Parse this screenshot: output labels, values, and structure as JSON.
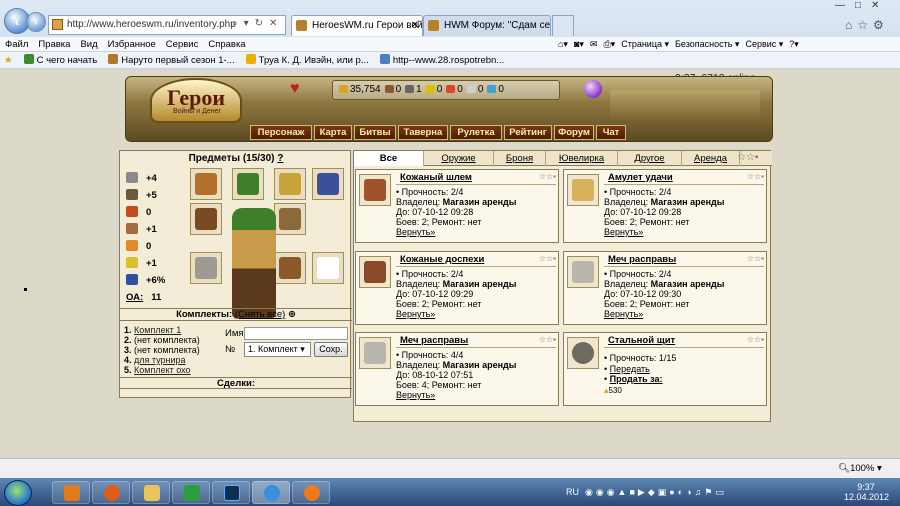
{
  "browser": {
    "url": "http://www.heroeswm.ru/inventory.php",
    "tabs": [
      {
        "label": "HeroesWM.ru Герои войн..."
      },
      {
        "label": "HWM Форум: \"Сдам сеты Ва..."
      }
    ],
    "menu": [
      "Файл",
      "Правка",
      "Вид",
      "Избранное",
      "Сервис",
      "Справка"
    ],
    "toolbar": {
      "page": "Страница ▾",
      "security": "Безопасность ▾",
      "service": "Сервис ▾"
    },
    "favorites": [
      {
        "label": "С чего начать",
        "color": "#3a8d2a"
      },
      {
        "label": "Наруто первый сезон 1-...",
        "color": "#b0782c"
      },
      {
        "label": "Труа К. Д. Ивэйн, или р...",
        "color": "#e7b300"
      },
      {
        "label": "http--www.28.rospotrebn...",
        "color": "#4a7fc0"
      }
    ]
  },
  "game": {
    "online": "9:37, 6712 online",
    "logo": "Герои",
    "logo_sub": "Войны и Денег",
    "resources": [
      {
        "value": "35,754",
        "color": "#d9a521"
      },
      {
        "value": "0",
        "color": "#8c5a32"
      },
      {
        "value": "1",
        "color": "#666666"
      },
      {
        "value": "0",
        "color": "#d6c400"
      },
      {
        "value": "0",
        "color": "#d9482a"
      },
      {
        "value": "0",
        "color": "#cfcfcf"
      },
      {
        "value": "0",
        "color": "#3aa3d8"
      }
    ],
    "nav": [
      "Персонаж",
      "Карта",
      "Битвы",
      "Таверна",
      "Рулетка",
      "Рейтинг",
      "Форум",
      "Чат"
    ]
  },
  "inventory": {
    "title": "Предметы (15/30)",
    "title_help": "?",
    "stats": [
      {
        "value": "+4",
        "icon": "attack-icon",
        "color": "#8a8a8a"
      },
      {
        "value": "+5",
        "icon": "defense-icon",
        "color": "#6b5a3a"
      },
      {
        "value": "0",
        "icon": "spellpower-icon",
        "color": "#c44b1a"
      },
      {
        "value": "+1",
        "icon": "knowledge-icon",
        "color": "#a86a3a"
      },
      {
        "value": "0",
        "icon": "luck-icon",
        "color": "#e08a2a"
      },
      {
        "value": "+1",
        "icon": "morale-icon",
        "color": "#d8c22a"
      },
      {
        "value": "+6%",
        "icon": "initiative-icon",
        "color": "#2f4f9f"
      },
      {
        "value": "11",
        "label": "ОА:",
        "icon": "",
        "color": ""
      }
    ],
    "sets_title": "Комплекты:",
    "sets_remove": "(Снять все)",
    "sets": [
      {
        "num": "1.",
        "label": "Комплект 1",
        "link": true
      },
      {
        "num": "2.",
        "label": "(нет комплекта)",
        "link": false
      },
      {
        "num": "3.",
        "label": "(нет комплекта)",
        "link": false
      },
      {
        "num": "4.",
        "label": "для турнира",
        "link": true
      },
      {
        "num": "5.",
        "label": "Комплект охо",
        "link": true
      }
    ],
    "name_label": "Имя",
    "name_value": "",
    "number_label": "№",
    "set_select": "1. Комплект",
    "save": "Сохр.",
    "deals_title": "Сделки:"
  },
  "item_tabs": [
    "Все",
    "Оружие",
    "Броня",
    "Ювелирка",
    "Другое",
    "Аренда"
  ],
  "items": [
    {
      "name": "Кожаный шлем",
      "durability": "Прочность: 2/4",
      "owner_label": "Владелец:",
      "owner": "Магазин аренды",
      "until": "До: 07-10-12 09:28",
      "battles": "Боев: 2;",
      "repair": "Ремонт: нет",
      "action": "Вернуть»",
      "color": "#a0522d"
    },
    {
      "name": "Амулет удачи",
      "durability": "Прочность: 2/4",
      "owner_label": "Владелец:",
      "owner": "Магазин аренды",
      "until": "До: 07-10-12 09:28",
      "battles": "Боев: 2;",
      "repair": "Ремонт: нет",
      "action": "Вернуть»",
      "color": "#d8b25a"
    },
    {
      "name": "Кожаные доспехи",
      "durability": "Прочность: 2/4",
      "owner_label": "Владелец:",
      "owner": "Магазин аренды",
      "until": "До: 07-10-12 09:29",
      "battles": "Боев: 2;",
      "repair": "Ремонт: нет",
      "action": "Вернуть»",
      "color": "#8b4a2a"
    },
    {
      "name": "Меч расправы",
      "durability": "Прочность: 2/4",
      "owner_label": "Владелец:",
      "owner": "Магазин аренды",
      "until": "До: 07-10-12 09:30",
      "battles": "Боев: 2;",
      "repair": "Ремонт: нет",
      "action": "Вернуть»",
      "color": "#b9b6ad"
    },
    {
      "name": "Меч расправы",
      "durability": "Прочность: 4/4",
      "owner_label": "Владелец:",
      "owner": "Магазин аренды",
      "until": "До: 08-10-12 07:51",
      "battles": "Боев: 4;",
      "repair": "Ремонт: нет",
      "action": "Вернуть»",
      "color": "#b9b6ad"
    },
    {
      "name": "Стальной щит",
      "durability": "Прочность: 1/15",
      "owner_label": "",
      "owner": "",
      "until": "Передать",
      "battles": "Продать за:",
      "repair": "",
      "action": "530",
      "color": "#6f6a60"
    }
  ],
  "status": {
    "zoom": "100%"
  },
  "taskbar": {
    "lang": "RU",
    "time": "9:37",
    "date": "12.04.2012"
  }
}
